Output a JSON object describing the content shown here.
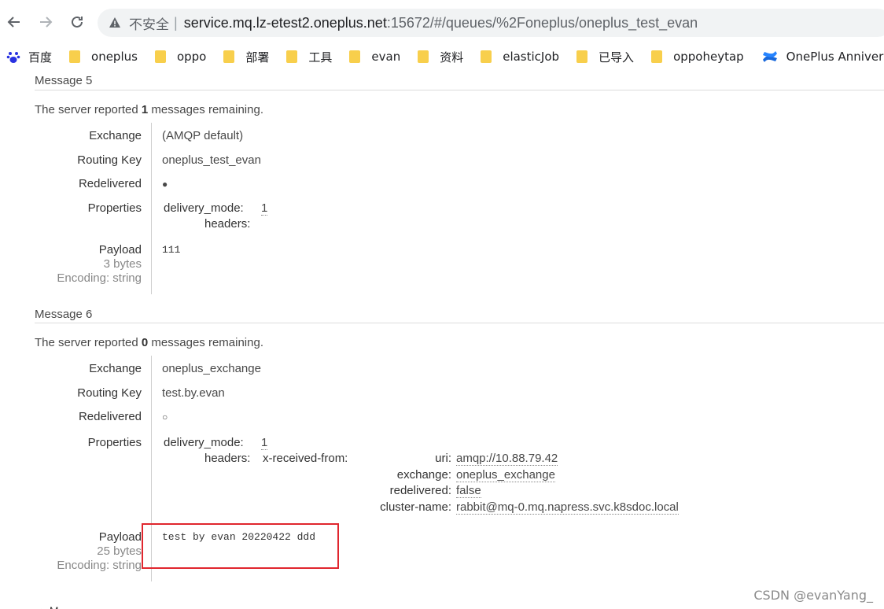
{
  "browser": {
    "back_icon": "back-arrow-icon",
    "forward_icon": "forward-arrow-icon",
    "reload_icon": "reload-icon",
    "security_label": "不安全",
    "url_host": "service.mq.lz-etest2.oneplus.net",
    "url_path": ":15672/#/queues/%2Foneplus/oneplus_test_evan"
  },
  "bookmarks": [
    "百度",
    "oneplus",
    "oppo",
    "部署",
    "工具",
    "evan",
    "资料",
    "elasticJob",
    "已导入",
    "oppoheytap",
    "OnePlus Annivers..."
  ],
  "messages": [
    {
      "title": "Message 5",
      "remaining_prefix": "The server reported ",
      "remaining_count": "1",
      "remaining_suffix": " messages remaining.",
      "labels": {
        "exchange": "Exchange",
        "routing_key": "Routing Key",
        "redelivered": "Redelivered",
        "properties": "Properties",
        "payload": "Payload"
      },
      "exchange": "(AMQP default)",
      "routing_key": "oneplus_test_evan",
      "redelivered": "●",
      "properties": {
        "delivery_mode_key": "delivery_mode:",
        "delivery_mode": "1",
        "headers_key": "headers:"
      },
      "payload": "111",
      "payload_size": "3 bytes",
      "encoding": "Encoding: string"
    },
    {
      "title": "Message 6",
      "remaining_prefix": "The server reported ",
      "remaining_count": "0",
      "remaining_suffix": " messages remaining.",
      "labels": {
        "exchange": "Exchange",
        "routing_key": "Routing Key",
        "redelivered": "Redelivered",
        "properties": "Properties",
        "payload": "Payload"
      },
      "exchange": "oneplus_exchange",
      "routing_key": "test.by.evan",
      "redelivered": "○",
      "properties": {
        "delivery_mode_key": "delivery_mode:",
        "delivery_mode": "1",
        "headers_key": "headers:",
        "header_name": "x-received-from:",
        "entries": [
          {
            "key": "uri:",
            "value": "amqp://10.88.79.42"
          },
          {
            "key": "exchange:",
            "value": "oneplus_exchange"
          },
          {
            "key": "redelivered:",
            "value": "false"
          },
          {
            "key": "cluster-name:",
            "value": "rabbit@mq-0.mq.napress.svc.k8sdoc.local"
          }
        ]
      },
      "payload": "test by evan 20220422 ddd",
      "payload_size": "25 bytes",
      "encoding": "Encoding: string"
    }
  ],
  "watermark": "CSDN @evanYang_",
  "cutoff_text": "▸ M"
}
